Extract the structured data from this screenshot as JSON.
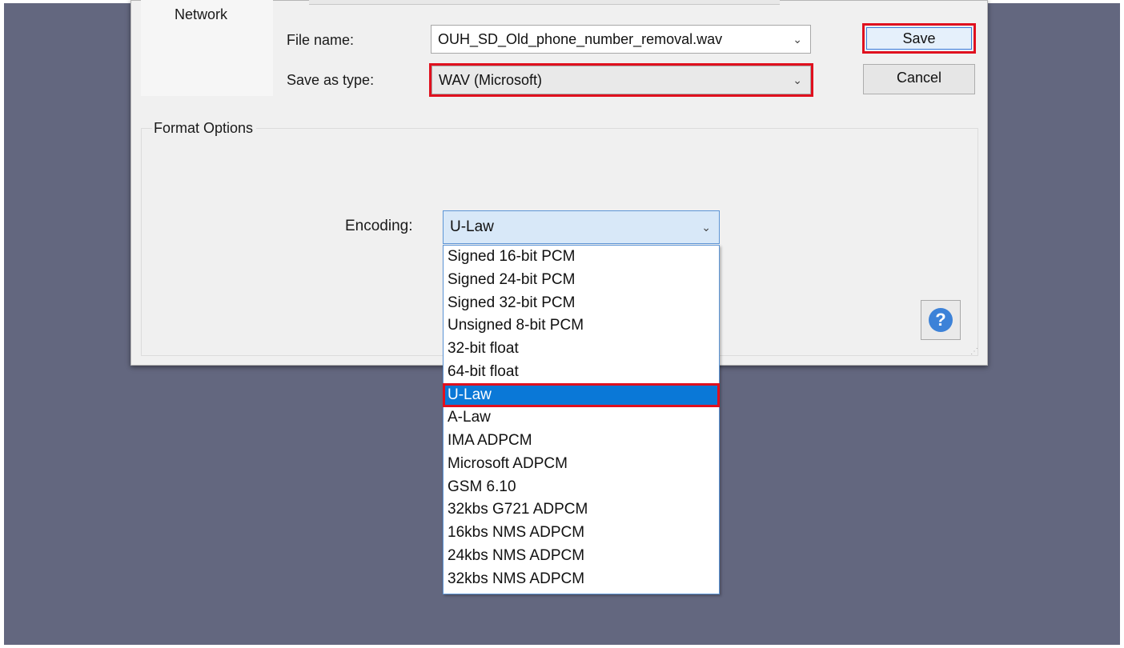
{
  "nav": {
    "network": "Network"
  },
  "file_name": {
    "label": "File name:",
    "value": "OUH_SD_Old_phone_number_removal.wav"
  },
  "save_as_type": {
    "label": "Save as type:",
    "value": "WAV (Microsoft)"
  },
  "buttons": {
    "save": "Save",
    "cancel": "Cancel",
    "help": "?"
  },
  "format_options": {
    "legend": "Format Options",
    "encoding_label": "Encoding:",
    "encoding_value": "U-Law",
    "encoding_options": [
      "Signed 16-bit PCM",
      "Signed 24-bit PCM",
      "Signed 32-bit PCM",
      "Unsigned 8-bit PCM",
      "32-bit float",
      "64-bit float",
      "U-Law",
      "A-Law",
      "IMA ADPCM",
      "Microsoft ADPCM",
      "GSM 6.10",
      "32kbs G721 ADPCM",
      "16kbs NMS ADPCM",
      "24kbs NMS ADPCM",
      "32kbs NMS ADPCM"
    ],
    "selected_index": 6
  },
  "icons": {
    "dropdown": "chevron-down-icon",
    "help": "help-icon"
  },
  "colors": {
    "highlight": "#e0101e",
    "selection": "#0a78d7",
    "desktop": "#63677f"
  }
}
